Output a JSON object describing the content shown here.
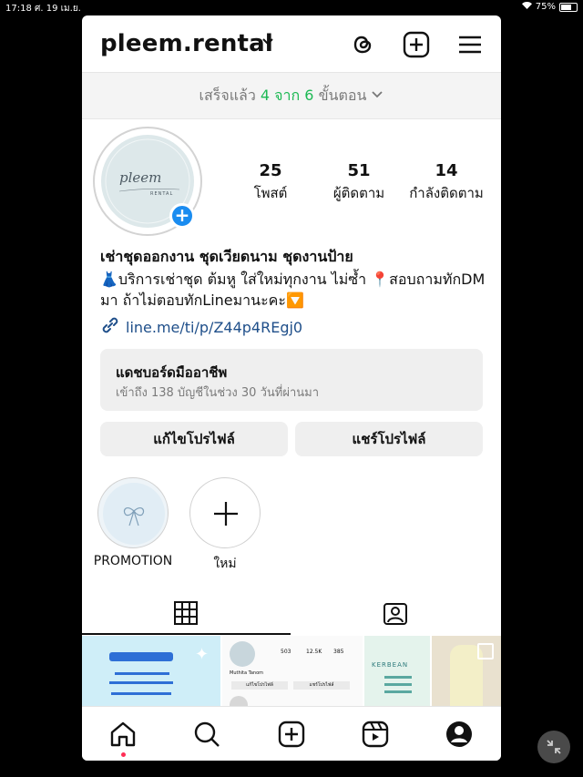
{
  "statusbar": {
    "time": "17:18",
    "date": "ศ. 19 เม.ย.",
    "battery": "75%"
  },
  "header": {
    "username": "pleem.rental",
    "icons": [
      "threads-icon",
      "create-icon",
      "menu-icon"
    ]
  },
  "progress": {
    "prefix": "เสร็จแล้ว ",
    "highlight": "4 จาก 6",
    "suffix": " ขั้นตอน"
  },
  "profile": {
    "avatar_text": "pleem",
    "avatar_subtext": "RENTAL",
    "add_badge": "+"
  },
  "stats": [
    {
      "value": "25",
      "label": "โพสต์"
    },
    {
      "value": "51",
      "label": "ผู้ติดตาม"
    },
    {
      "value": "14",
      "label": "กำลังติดตาม"
    }
  ],
  "bio": {
    "name": "เช่าชุดออกงาน ชุดเวียดนาม ชุดงานป้าย",
    "text": "👗บริการเช่าชุด ต้มหู ใส่ใหม่ทุกงาน ไม่ซ้ำ 📍สอบถามทักDM มา ถ้าไม่ตอบทักLineมานะคะ🔽",
    "link": "line.me/ti/p/Z44p4REgj0"
  },
  "dashboard": {
    "title": "แดชบอร์ดมืออาชีพ",
    "subtitle": "เข้าถึง 138 บัญชีในช่วง 30 วันที่ผ่านมา"
  },
  "buttons": {
    "edit": "แก้ไขโปรไฟล์",
    "share": "แชร์โปรไฟล์"
  },
  "highlights": [
    {
      "label": "PROMOTION"
    },
    {
      "label": "ใหม่"
    }
  ],
  "grid": {
    "cell2": {
      "name": "Muthita Tanom",
      "stats": [
        "503",
        "12.5K",
        "385"
      ],
      "btn1": "แก้ไขโปรไฟล์",
      "btn2": "แชร์โปรไฟล์"
    },
    "cell3_text": "KERBEAN"
  },
  "colors": {
    "accent": "#1a8cf0",
    "green": "#1db954",
    "link": "#1f4f8a"
  }
}
